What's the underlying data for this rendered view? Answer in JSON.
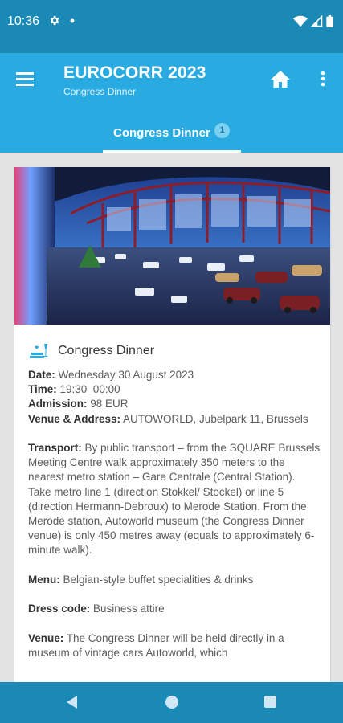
{
  "status_bar": {
    "time": "10:36",
    "icons": [
      "gear-icon",
      "dot-icon",
      "wifi-icon",
      "signal-icon",
      "battery-icon"
    ]
  },
  "app_bar": {
    "title": "EUROCORR 2023",
    "subtitle": "Congress Dinner",
    "icons": [
      "menu-icon",
      "home-icon",
      "more-vert-icon"
    ]
  },
  "tabs": [
    {
      "label": "Congress Dinner",
      "badge": "1",
      "selected": true
    }
  ],
  "card": {
    "image": "Autoworld museum hall with vintage cars",
    "section_title": "Congress Dinner",
    "section_icon": "dinner-cheers-icon",
    "date_label": "Date:",
    "date_value": " Wednesday 30 August 2023",
    "time_label": "Time:",
    "time_value": " 19:30–00:00",
    "admission_label": "Admission:",
    "admission_value": " 98 EUR",
    "venue_addr_label": "Venue & Address:",
    "venue_addr_value": " AUTOWORLD, Jubelpark 11, Brussels",
    "transport_label": "Transport:",
    "transport_value": " By public transport – from the SQUARE Brussels Meeting Centre walk approximately 350 meters to the nearest metro station – Gare Centrale (Central Station). Take metro line 1 (direction Stokkel/ Stockel) or line 5 (direction Hermann-Debroux) to Merode Station. From the Merode station, Autoworld museum (the Congress Dinner venue) is only 450 metres away (equals to approximately 6-minute walk).",
    "menu_label": "Menu:",
    "menu_value": " Belgian-style buffet specialities & drinks",
    "dress_label": "Dress code:",
    "dress_value": " Business attire",
    "venue_label": "Venue:",
    "venue_value": " The Congress Dinner will be held directly in a museum of vintage cars Autoworld, which"
  },
  "nav_bar": {
    "icons": [
      "back-icon",
      "home-circle-icon",
      "recent-apps-icon"
    ]
  },
  "colors": {
    "status_bar": "#1a89b6",
    "app_bar": "#29abe2",
    "badge": "#7cd0f0",
    "text_dark": "#333333",
    "text_body": "#5b5b5b"
  }
}
